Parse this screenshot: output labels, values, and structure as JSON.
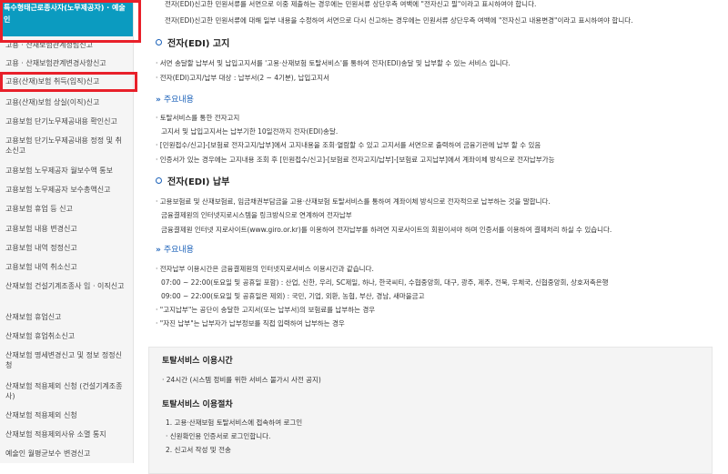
{
  "sidebar": {
    "header": "특수형태근로종사자(노무제공자) · 예술인",
    "items": [
      "고용 · 산재보험관계성립신고",
      "고용 · 산재보험관계변경사항신고",
      "고용(산재)보험 취득(입직)신고",
      "고용(산재)보험 상실(이직)신고",
      "고용보험 단기노무제공내용 확인신고",
      "고용보험 단기노무제공내용 정정 및 취소신고",
      "고용보험 노무제공자 월보수액 통보",
      "고용보험 노무제공자 보수총액신고",
      "고용보험 휴업 등 신고",
      "고용보험 내용 변경신고",
      "고용보험 내역 정정신고",
      "고용보험 내역 취소신고",
      "산재보험 건설기계조종사 입 · 이직신고",
      "산재보험 휴업신고",
      "산재보험 휴업취소신고",
      "산재보험 명세변경신고 및 정보 정정신청",
      "산재보험 적용제외 신청 (건설기계조종사)",
      "산재보험 적용제외 신청",
      "산재보험 적용제외사유 소멸 통지",
      "예술인 월평균보수 변경신고"
    ]
  },
  "main": {
    "intro": [
      "전자(EDI)신고한 민원서류를 서면으로 이중 제출하는 경우에는 민원서류 상단우측 여백에 \"전자신고 필\"이라고 표시하여야 합니다.",
      "전자(EDI)신고한 민원서류에 대해 일부 내용을 수정하여 서면으로 다시 신고하는 경우에는 민원서류 상단우측 여백에 \"전자신고 내용변경\"이라고 표시하여야 합니다."
    ],
    "section1": {
      "title": "전자(EDI) 고지",
      "lines": [
        "· 서면 송달할 납부서 및 납입고지서를 '고용·산재보험 토탈서비스'를 통하여 전자(EDI)송달 및 납부할 수 있는 서비스 입니다.",
        "· 전자(EDI)고지/납부 대상 : 납부서(2 ~ 4기분), 납입고지서"
      ],
      "sub": "주요내용",
      "sub_lines": [
        "· 토탈서비스를 통한 전자고지",
        "고지서 및 납입고지서는 납부기한 10일전까지 전자(EDI)송달.",
        "· [민원접수/신고]-[보험료 전자고지/납부]에서 고지내용을 조회·열람할 수 있고 고지서를 서면으로 출력하여 금융기관에 납부 할 수 있음",
        "· 인증서가 있는 경우에는 고지내용 조회 후 [민원접수/신고]-[보험료 전자고지/납부]-[보험료 고지납부]에서 계좌이체 방식으로 전자납부가능"
      ]
    },
    "section2": {
      "title": "전자(EDI) 납부",
      "lines": [
        "· 고용보험료 및 산재보험료, 임금채권부담금을 고용·산재보험 토탈서비스를 통하여 계좌이체 방식으로 전자적으로 납부하는 것을 말합니다.",
        "금융결제원의 인터넷지로시스템을 링크방식으로 연계하여 전자납부",
        "금융결제원 인터넷 지로사이트(www.giro.or.kr)를 이용하여 전자납부를 하려면 지로사이트의 회원이셔야 하며 인증서를 이용하여 결제처리 하실 수 있습니다."
      ],
      "sub": "주요내용",
      "sub_lines": [
        "· 전자납부 이용시간은 금융결제원의 인터넷지로서비스 이용시간과 같습니다.",
        "07:00 ~ 22:00(토요일 및 공휴일 포함) : 산업, 신한, 우리, SC제일, 하나, 한국씨티, 수협중앙회, 대구, 광주, 제주, 전북, 우체국, 신협중앙회, 상호저축은행",
        "09:00 ~ 22:00(토요일 및 공휴일은 제외) : 국민, 기업, 외환, 농협, 부산, 경남, 새마을금고",
        "· \"고지납부\"는 공단이 송달한 고지서(또는 납부서)의 보험료를 납부하는 경우",
        "· \"자진 납부\"는 납부자가 납부정보를 직접 입력하여 납부하는 경우"
      ]
    },
    "box": {
      "title1": "토탈서비스 이용시간",
      "line1": "· 24시간 (시스템 정비를 위한 서비스 불가시 사전 공지)",
      "title2": "토탈서비스 이용절차",
      "steps": [
        "1. 고용·산재보험 토탈서비스에 접속하여 로그인",
        "· 신원확인용 인증서로 로그인합니다.",
        "2. 신고서 작성 및 전송"
      ]
    }
  }
}
